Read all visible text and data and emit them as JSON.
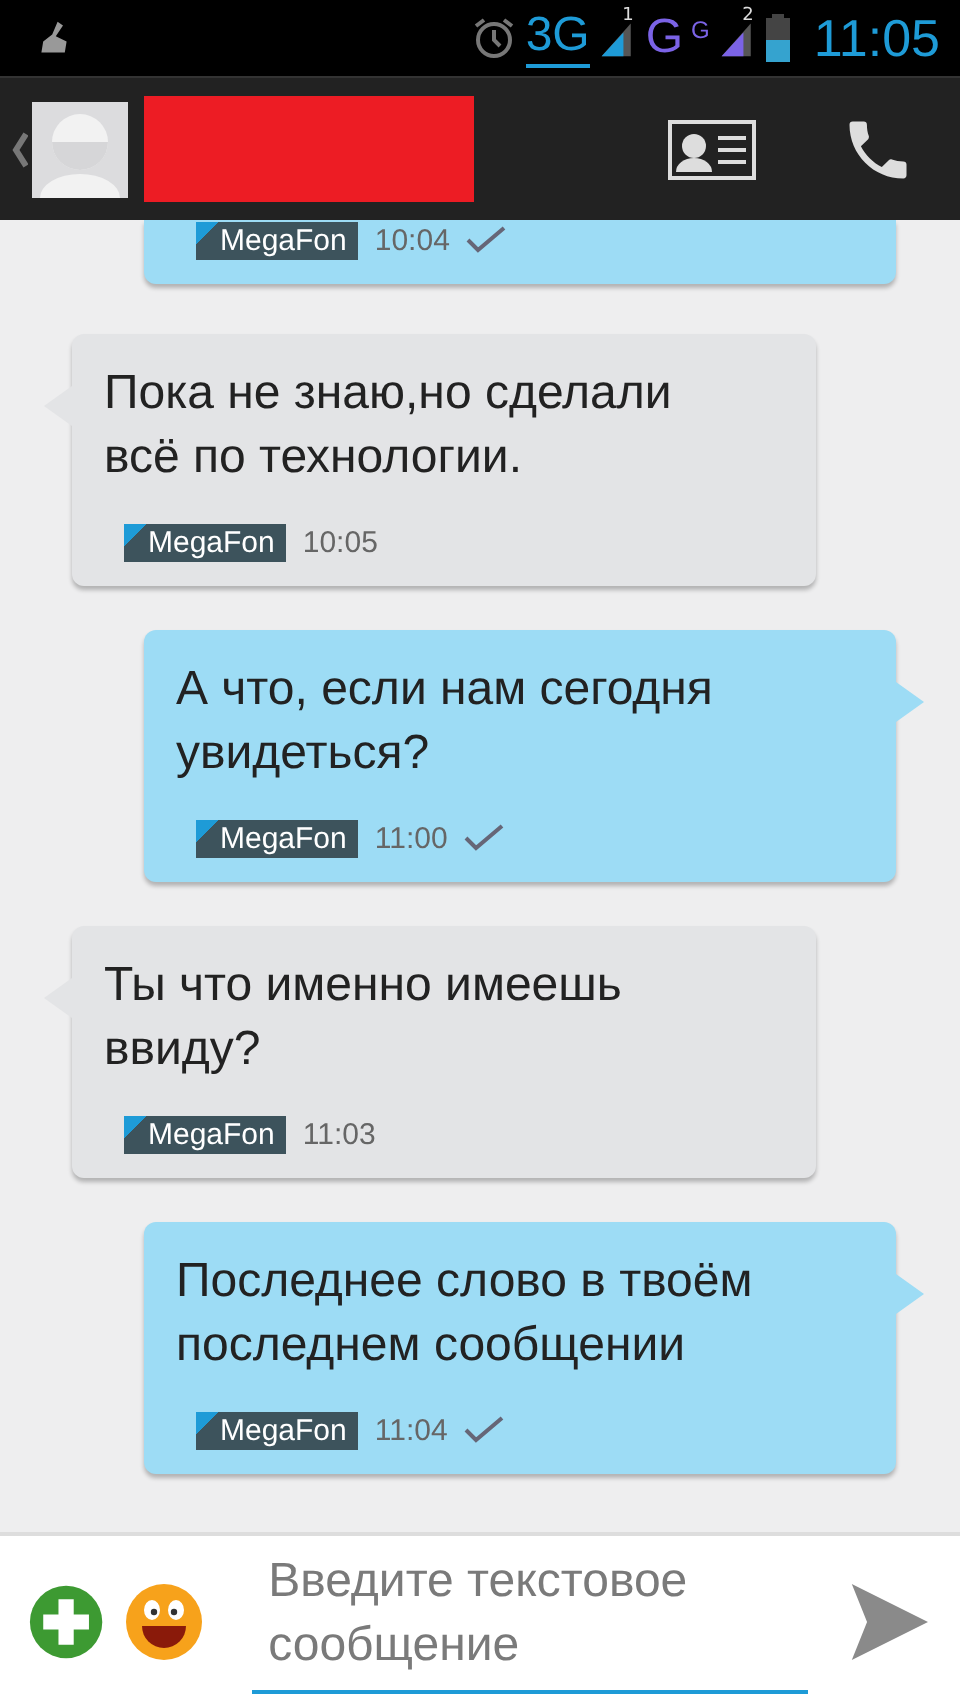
{
  "status_bar": {
    "networks": [
      {
        "label": "3G",
        "sim": "1",
        "color": "#1e9bd7",
        "active": true
      },
      {
        "label": "G",
        "sup": "G",
        "sim": "2",
        "color": "#7b63e6",
        "active": false
      }
    ],
    "time": "11:05"
  },
  "header": {
    "name_redacted": true
  },
  "messages": [
    {
      "kind": "outgoing",
      "cut": true,
      "operator": "MegaFon",
      "time": "10:04",
      "delivered": true
    },
    {
      "kind": "incoming",
      "cut": false,
      "text": "Пока не знаю,но сделали всё по технологии.",
      "operator": "MegaFon",
      "time": "10:05",
      "delivered": false
    },
    {
      "kind": "outgoing",
      "cut": false,
      "text": "А что, если нам сегодня увидеться?",
      "operator": "MegaFon",
      "time": "11:00",
      "delivered": true
    },
    {
      "kind": "incoming",
      "cut": false,
      "text": "Ты что именно имеешь ввиду?",
      "operator": "MegaFon",
      "time": "11:03",
      "delivered": false
    },
    {
      "kind": "outgoing",
      "cut": false,
      "text": "Последнее слово в твоём последнем сообщении",
      "operator": "MegaFon",
      "time": "11:04",
      "delivered": true
    }
  ],
  "composer": {
    "placeholder": "Введите текстовое сообщение"
  }
}
